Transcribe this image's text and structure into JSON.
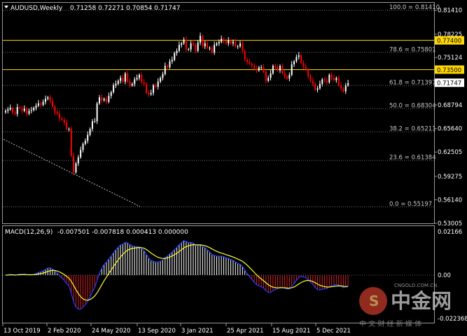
{
  "header": {
    "symbol_label": "AUDUSD,Weekly",
    "ohlc_text": "0.71258 0.72271 0.70854 0.71747"
  },
  "macd": {
    "label": "MACD(12,26,9)",
    "values_text": "-0.007501 -0.007818 0.000413 0.000000",
    "axis_max": "0.02166",
    "axis_zero": "0.00",
    "axis_min": "-0.022368",
    "colors": {
      "macd": "#1e3cff",
      "signal": "#ffff33",
      "pos": "#ffffff",
      "neg": "#d42020"
    }
  },
  "price_axis": {
    "ticks": [
      "0.81410",
      "0.78225",
      "0.75124",
      "0.71747",
      "0.68794",
      "0.65640",
      "0.62505",
      "0.59275",
      "0.56140",
      "0.53005"
    ]
  },
  "fib_levels": [
    {
      "label": "100.0 = 0.81410",
      "value": 0.8141
    },
    {
      "label": "78.6 = 0.75801",
      "value": 0.75801
    },
    {
      "label": "61.8 = 0.71397",
      "value": 0.71397
    },
    {
      "label": "50.0 = 0.68304",
      "value": 0.68304
    },
    {
      "label": "38.2 = 0.65211",
      "value": 0.65211
    },
    {
      "label": "23.6 = 0.61384",
      "value": 0.61384
    },
    {
      "label": "0.0 = 0.55197",
      "value": 0.55197
    }
  ],
  "horizontal_lines": [
    {
      "label": "0.77400",
      "value": 0.774,
      "color": "#ffd700"
    },
    {
      "label": "0.73500",
      "value": 0.735,
      "color": "#ffd700"
    }
  ],
  "current_price_label": "0.71747",
  "x_axis_labels": [
    "13 Oct 2019",
    "2 Feb 2020",
    "24 May 2020",
    "13 Sep 2020",
    "3 Jan 2021",
    "25 Apr 2021",
    "15 Aug 2021",
    "5 Dec 2021"
  ],
  "watermark": {
    "brand": "中金网",
    "domain": "CNGOLD.COM.CN",
    "slogan": "中 文 财 经 新 媒 体"
  },
  "chart_data": {
    "type": "candlestick",
    "title": "AUDUSD,Weekly",
    "ylim": [
      0.53005,
      0.8241
    ],
    "colors": {
      "up": "#ffffff",
      "down": "#ff0000"
    },
    "candles_close": [
      0.68,
      0.682,
      0.684,
      0.678,
      0.676,
      0.685,
      0.684,
      0.68,
      0.683,
      0.676,
      0.68,
      0.681,
      0.684,
      0.687,
      0.69,
      0.688,
      0.692,
      0.696,
      0.698,
      0.693,
      0.686,
      0.678,
      0.676,
      0.67,
      0.668,
      0.664,
      0.656,
      0.656,
      0.62,
      0.598,
      0.61,
      0.618,
      0.628,
      0.636,
      0.64,
      0.648,
      0.656,
      0.666,
      0.666,
      0.69,
      0.698,
      0.694,
      0.696,
      0.692,
      0.7,
      0.705,
      0.714,
      0.716,
      0.72,
      0.724,
      0.719,
      0.73,
      0.719,
      0.714,
      0.716,
      0.722,
      0.724,
      0.728,
      0.718,
      0.716,
      0.704,
      0.702,
      0.704,
      0.714,
      0.712,
      0.719,
      0.724,
      0.729,
      0.74,
      0.738,
      0.746,
      0.748,
      0.757,
      0.76,
      0.768,
      0.77,
      0.775,
      0.762,
      0.762,
      0.77,
      0.768,
      0.76,
      0.771,
      0.78,
      0.766,
      0.77,
      0.764,
      0.764,
      0.758,
      0.768,
      0.77,
      0.772,
      0.776,
      0.773,
      0.77,
      0.774,
      0.77,
      0.772,
      0.766,
      0.766,
      0.77,
      0.76,
      0.748,
      0.745,
      0.743,
      0.74,
      0.736,
      0.734,
      0.738,
      0.738,
      0.732,
      0.72,
      0.724,
      0.73,
      0.74,
      0.738,
      0.734,
      0.74,
      0.73,
      0.726,
      0.723,
      0.728,
      0.742,
      0.746,
      0.752,
      0.754,
      0.744,
      0.739,
      0.735,
      0.726,
      0.72,
      0.716,
      0.708,
      0.71,
      0.716,
      0.722,
      0.72,
      0.718,
      0.728,
      0.724,
      0.721,
      0.724,
      0.714,
      0.71,
      0.706,
      0.714,
      0.717
    ]
  }
}
